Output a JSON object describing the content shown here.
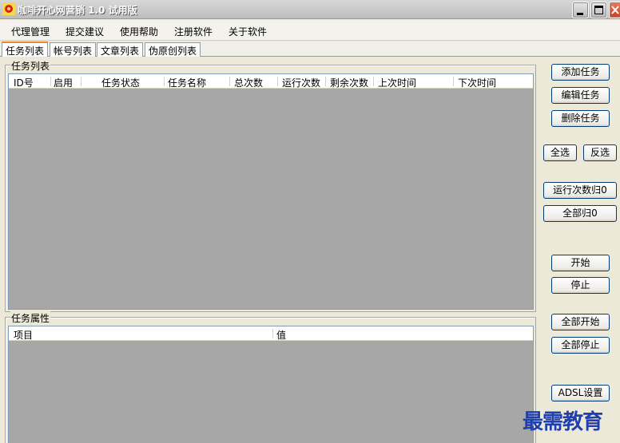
{
  "window": {
    "title": "咖啡开心网营销 1.0 试用版"
  },
  "menu": [
    "代理管理",
    "提交建议",
    "使用帮助",
    "注册软件",
    "关于软件"
  ],
  "tabs": [
    "任务列表",
    "帐号列表",
    "文章列表",
    "伪原创列表"
  ],
  "task_list": {
    "title": "任务列表",
    "columns": [
      "ID号",
      "启用",
      "任务状态",
      "任务名称",
      "总次数",
      "运行次数",
      "剩余次数",
      "上次时间",
      "下次时间"
    ]
  },
  "task_props": {
    "title": "任务属性",
    "columns": [
      "项目",
      "值"
    ]
  },
  "buttons": {
    "add": "添加任务",
    "edit": "编辑任务",
    "delete": "删除任务",
    "select_all": "全选",
    "invert": "反选",
    "reset_run": "运行次数归0",
    "reset_all": "全部归0",
    "start": "开始",
    "stop": "停止",
    "start_all": "全部开始",
    "stop_all": "全部停止",
    "adsl": "ADSL设置"
  },
  "watermark": "最需教育",
  "colors": {
    "list_bg": "#a7a7a7",
    "active_tab_accent": "#e68b2c",
    "button_border": "#003c74"
  }
}
